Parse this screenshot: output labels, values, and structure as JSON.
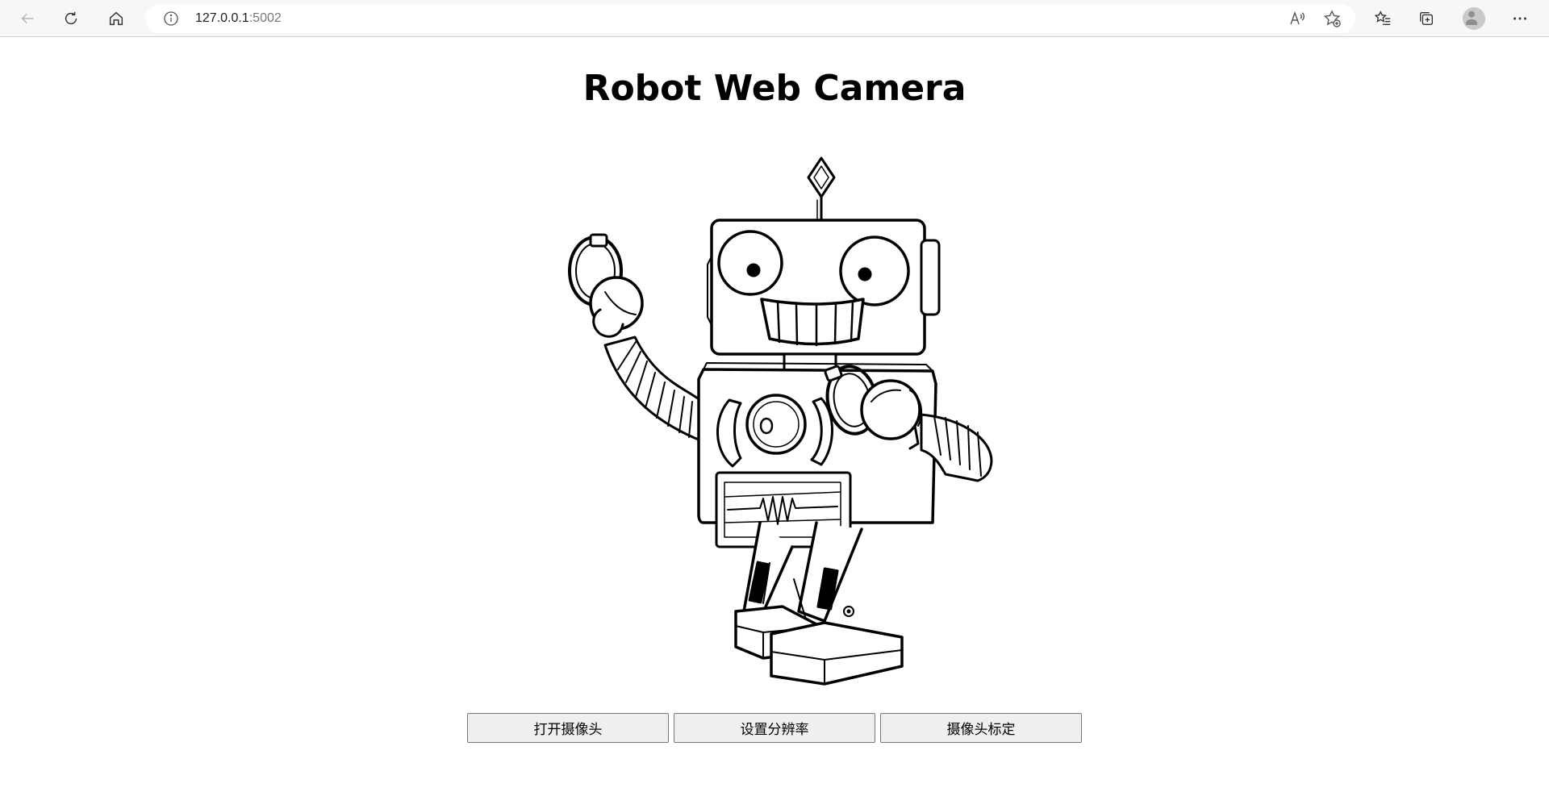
{
  "browser": {
    "url_host": "127.0.0.1",
    "url_port": ":5002",
    "icons": {
      "back": "back-arrow-icon",
      "refresh": "refresh-icon",
      "home": "home-icon",
      "info": "info-icon",
      "read_aloud": "read-aloud-icon",
      "add_favorite": "add-favorite-icon",
      "favorites": "favorites-icon",
      "collections": "collections-icon",
      "profile": "profile-avatar",
      "more": "more-icon"
    }
  },
  "page": {
    "title": "Robot Web Camera",
    "image_alt": "robot-illustration"
  },
  "buttons": {
    "open_camera": "打开摄像头",
    "set_resolution": "设置分辨率",
    "calibrate": "摄像头标定"
  },
  "colors": {
    "toolbar_bg": "#f7f7f7",
    "button_bg": "#efefef",
    "button_border": "#767676"
  }
}
